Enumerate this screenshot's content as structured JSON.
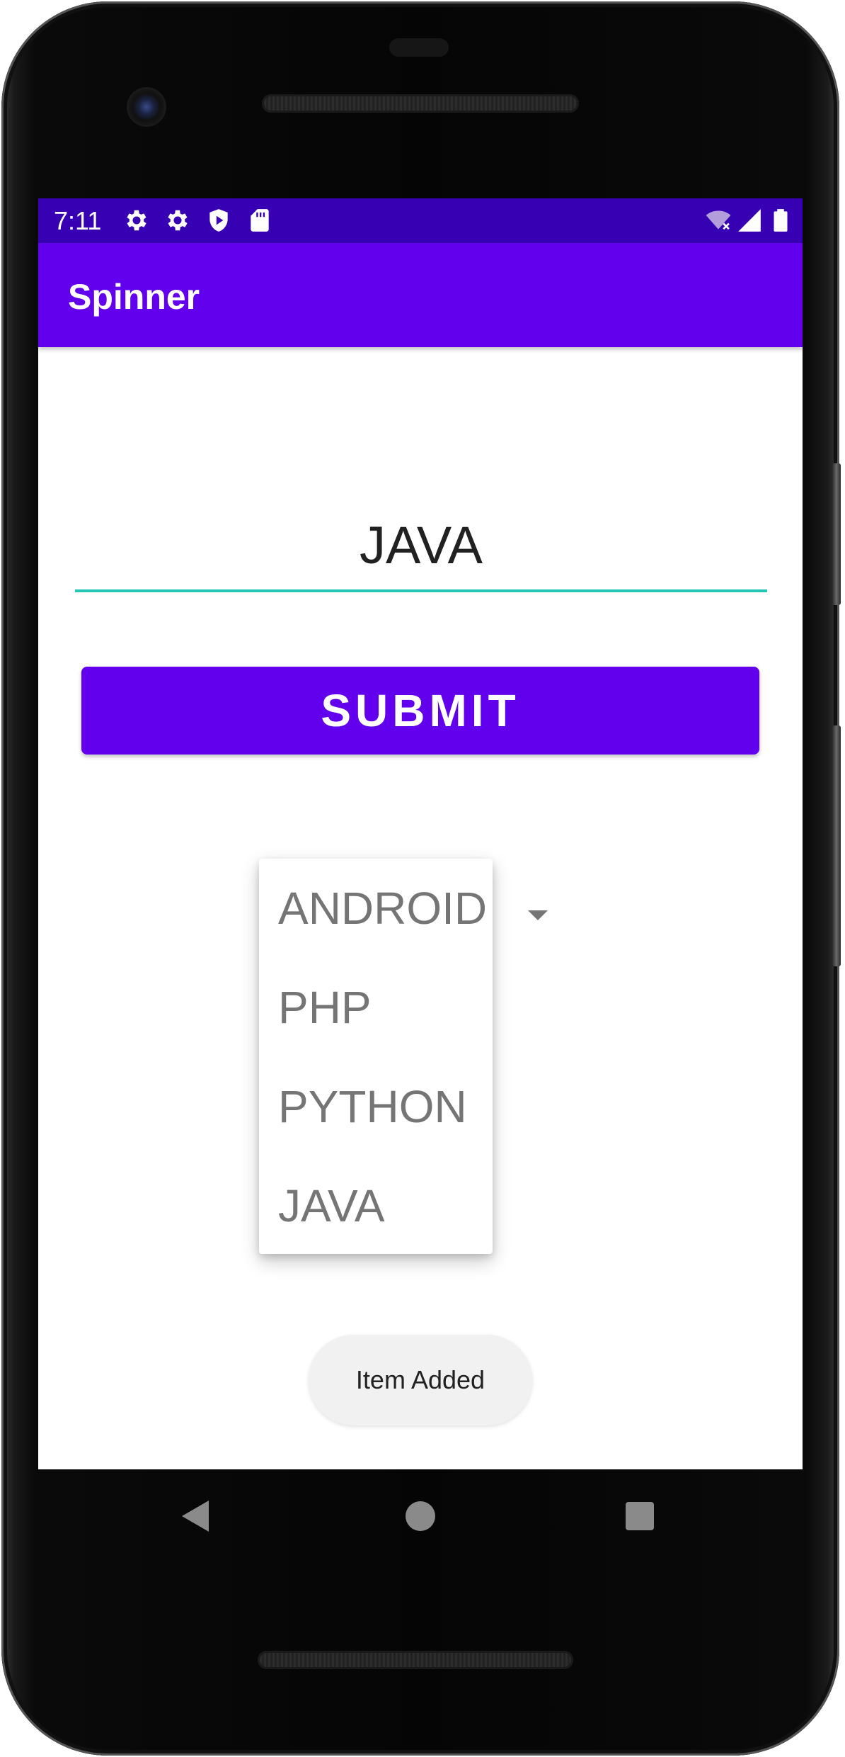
{
  "status_bar": {
    "time": "7:11",
    "left_icons": [
      "gear-icon",
      "gear-icon",
      "shield-play-icon",
      "sd-card-icon"
    ],
    "right_icons": [
      "wifi-off-icon",
      "signal-icon",
      "battery-icon"
    ]
  },
  "app_bar": {
    "title": "Spinner"
  },
  "form": {
    "edit_text_value": "JAVA",
    "submit_label": "SUBMIT"
  },
  "spinner": {
    "options": [
      "ANDROID",
      "PHP",
      "PYTHON",
      "JAVA"
    ]
  },
  "toast": {
    "message": "Item Added"
  },
  "navigation": {
    "buttons": [
      "back-icon",
      "home-icon",
      "recents-icon"
    ]
  },
  "colors": {
    "status_bar": "#3700b3",
    "primary": "#6200ee",
    "accent": "#26c6b6"
  }
}
